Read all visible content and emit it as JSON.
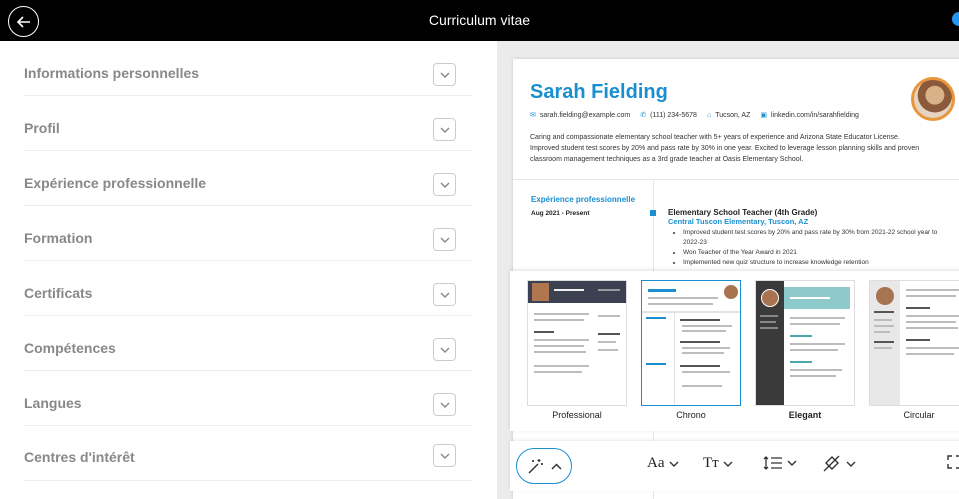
{
  "header": {
    "title": "Curriculum vitae"
  },
  "sections": [
    {
      "label": "Informations personnelles"
    },
    {
      "label": "Profil"
    },
    {
      "label": "Expérience professionnelle"
    },
    {
      "label": "Formation"
    },
    {
      "label": "Certificats"
    },
    {
      "label": "Compétences"
    },
    {
      "label": "Langues"
    },
    {
      "label": "Centres d'intérêt"
    }
  ],
  "resume": {
    "name": "Sarah Fielding",
    "email": "sarah.fielding@example.com",
    "phone": "(111) 234-5678",
    "location": "Tucson, AZ",
    "linkedin": "linkedin.com/in/sarahfielding",
    "summary": "Caring and compassionate elementary school teacher with 5+ years of experience and Arizona State Educator License. Improved student test scores by 20% and pass rate by 30% in one year. Excited to leverage lesson planning skills and proven classroom management techniques as a 3rd grade teacher at Oasis Elementary School.",
    "section_title": "Expérience professionnelle",
    "date": "Aug 2021 - Present",
    "job_title": "Elementary School Teacher (4th Grade)",
    "job_org": "Central Tuscon Elementary, Tuscon, AZ",
    "bullets": [
      "Improved student test scores by 20% and pass rate by 30% from 2021-22 school year to 2022-23",
      "Won Teacher of the Year Award in 2021",
      "Implemented new quiz structure to increase knowledge retention"
    ]
  },
  "templates": [
    {
      "label": "Professional"
    },
    {
      "label": "Chrono"
    },
    {
      "label": "Elegant"
    },
    {
      "label": "Circular"
    }
  ],
  "toolbar": {
    "font_label": "Aa",
    "size_label": "Tт"
  },
  "colors": {
    "accent": "#1a8fd0",
    "topbar": "#000000"
  }
}
